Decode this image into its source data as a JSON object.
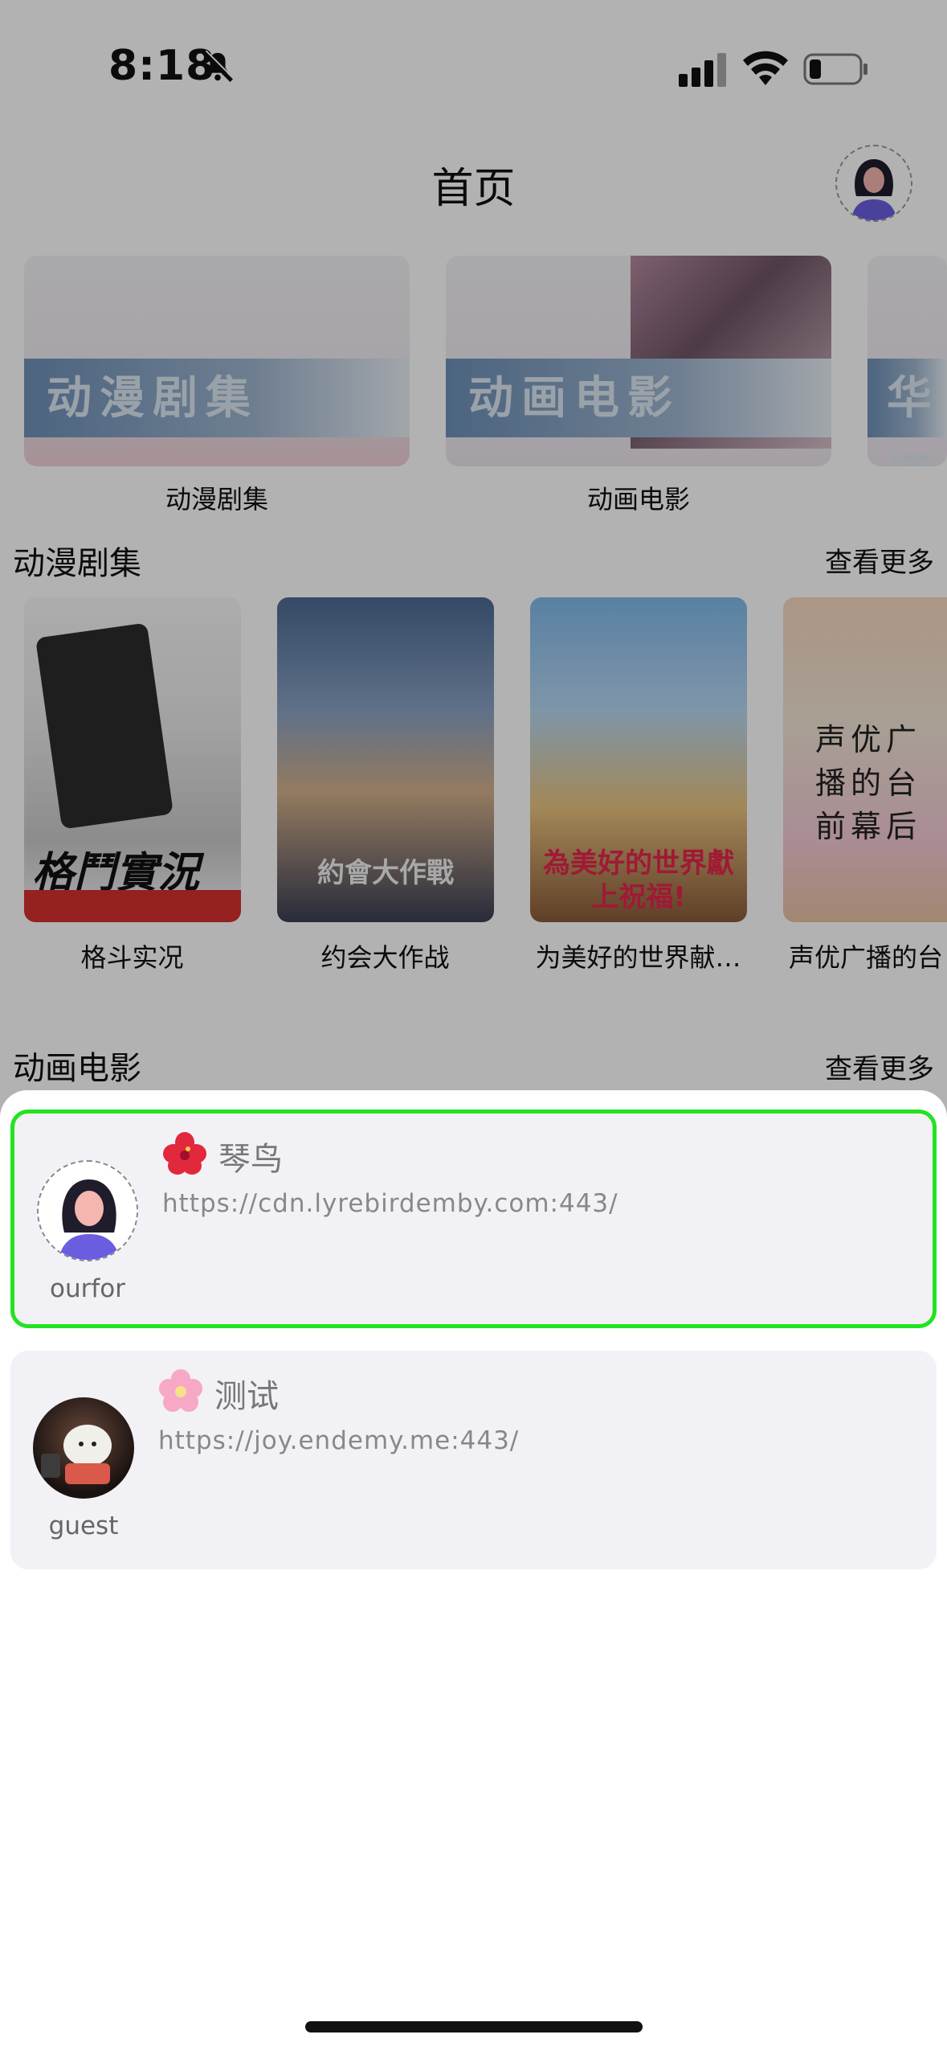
{
  "status_bar": {
    "time": "8:18"
  },
  "header": {
    "title": "首页"
  },
  "categories": [
    {
      "banner_text": "动漫剧集",
      "label": "动漫剧集"
    },
    {
      "banner_text": "动画电影",
      "label": "动画电影"
    },
    {
      "banner_text": "华语",
      "label": ""
    }
  ],
  "sections": {
    "anime_series": {
      "title": "动漫剧集",
      "see_more": "查看更多",
      "items": [
        {
          "label": "格斗实况",
          "poster_text": "格鬥實況"
        },
        {
          "label": "约会大作战",
          "poster_text": "約會大作戰"
        },
        {
          "label": "为美好的世界献…",
          "poster_text": "為美好的世界獻上祝福!"
        },
        {
          "label": "声优广播的台",
          "poster_text": "声优广播的台前幕后"
        }
      ]
    },
    "anime_movies": {
      "title": "动画电影",
      "see_more": "查看更多"
    }
  },
  "server_sheet": {
    "servers": [
      {
        "emoji": "hibiscus-icon",
        "name": "琴鸟",
        "url": "https://cdn.lyrebirdemby.com:443/",
        "user": "ourfor",
        "selected": true
      },
      {
        "emoji": "cherry-blossom-icon",
        "name": "测试",
        "url": "https://joy.endemy.me:443/",
        "user": "guest",
        "selected": false
      }
    ]
  },
  "colors": {
    "selected_border": "#22e322",
    "card_bg": "#f2f1f6",
    "overlay": "rgba(0,0,0,0.30)"
  }
}
